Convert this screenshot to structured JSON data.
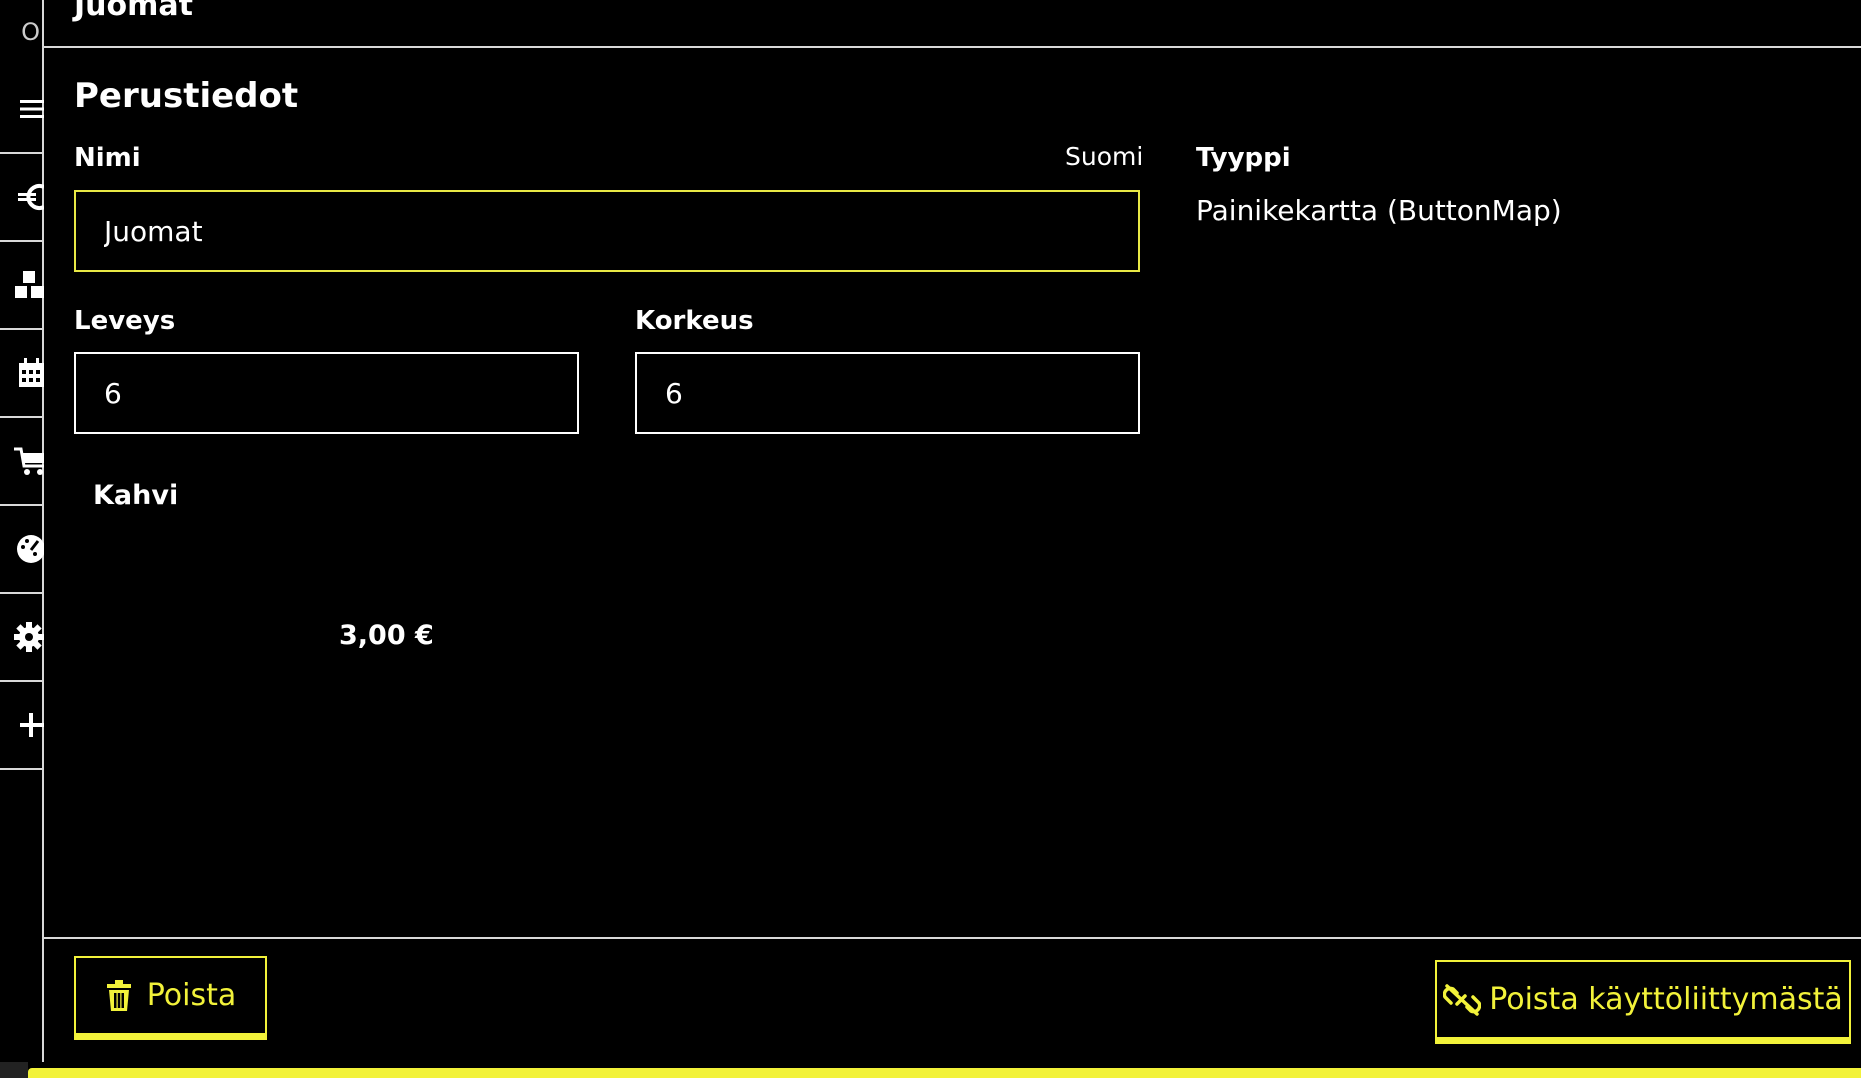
{
  "header": {
    "title": "Juomat"
  },
  "sidebar": {
    "first_glyph": "O",
    "items": [
      {
        "icon": "menu-icon"
      },
      {
        "icon": "euro-icon"
      },
      {
        "icon": "cubes-icon"
      },
      {
        "icon": "calendar-icon"
      },
      {
        "icon": "cart-icon"
      },
      {
        "icon": "palette-icon"
      },
      {
        "icon": "gear-icon"
      },
      {
        "icon": "plus-icon"
      }
    ]
  },
  "section": {
    "title": "Perustiedot"
  },
  "form": {
    "name_label": "Nimi",
    "name_language": "Suomi",
    "name_value": "Juomat",
    "width_label": "Leveys",
    "width_value": "6",
    "height_label": "Korkeus",
    "height_value": "6",
    "type_label": "Tyyppi",
    "type_value": "Painikekartta (ButtonMap)"
  },
  "tile": {
    "name": "Kahvi",
    "price": "3,00 €"
  },
  "footer": {
    "delete_label": "Poista",
    "remove_ui_label": "Poista käyttöliittymästä"
  },
  "colors": {
    "accent": "#f2f23a",
    "background": "#000000",
    "border": "#d9d9d9"
  }
}
